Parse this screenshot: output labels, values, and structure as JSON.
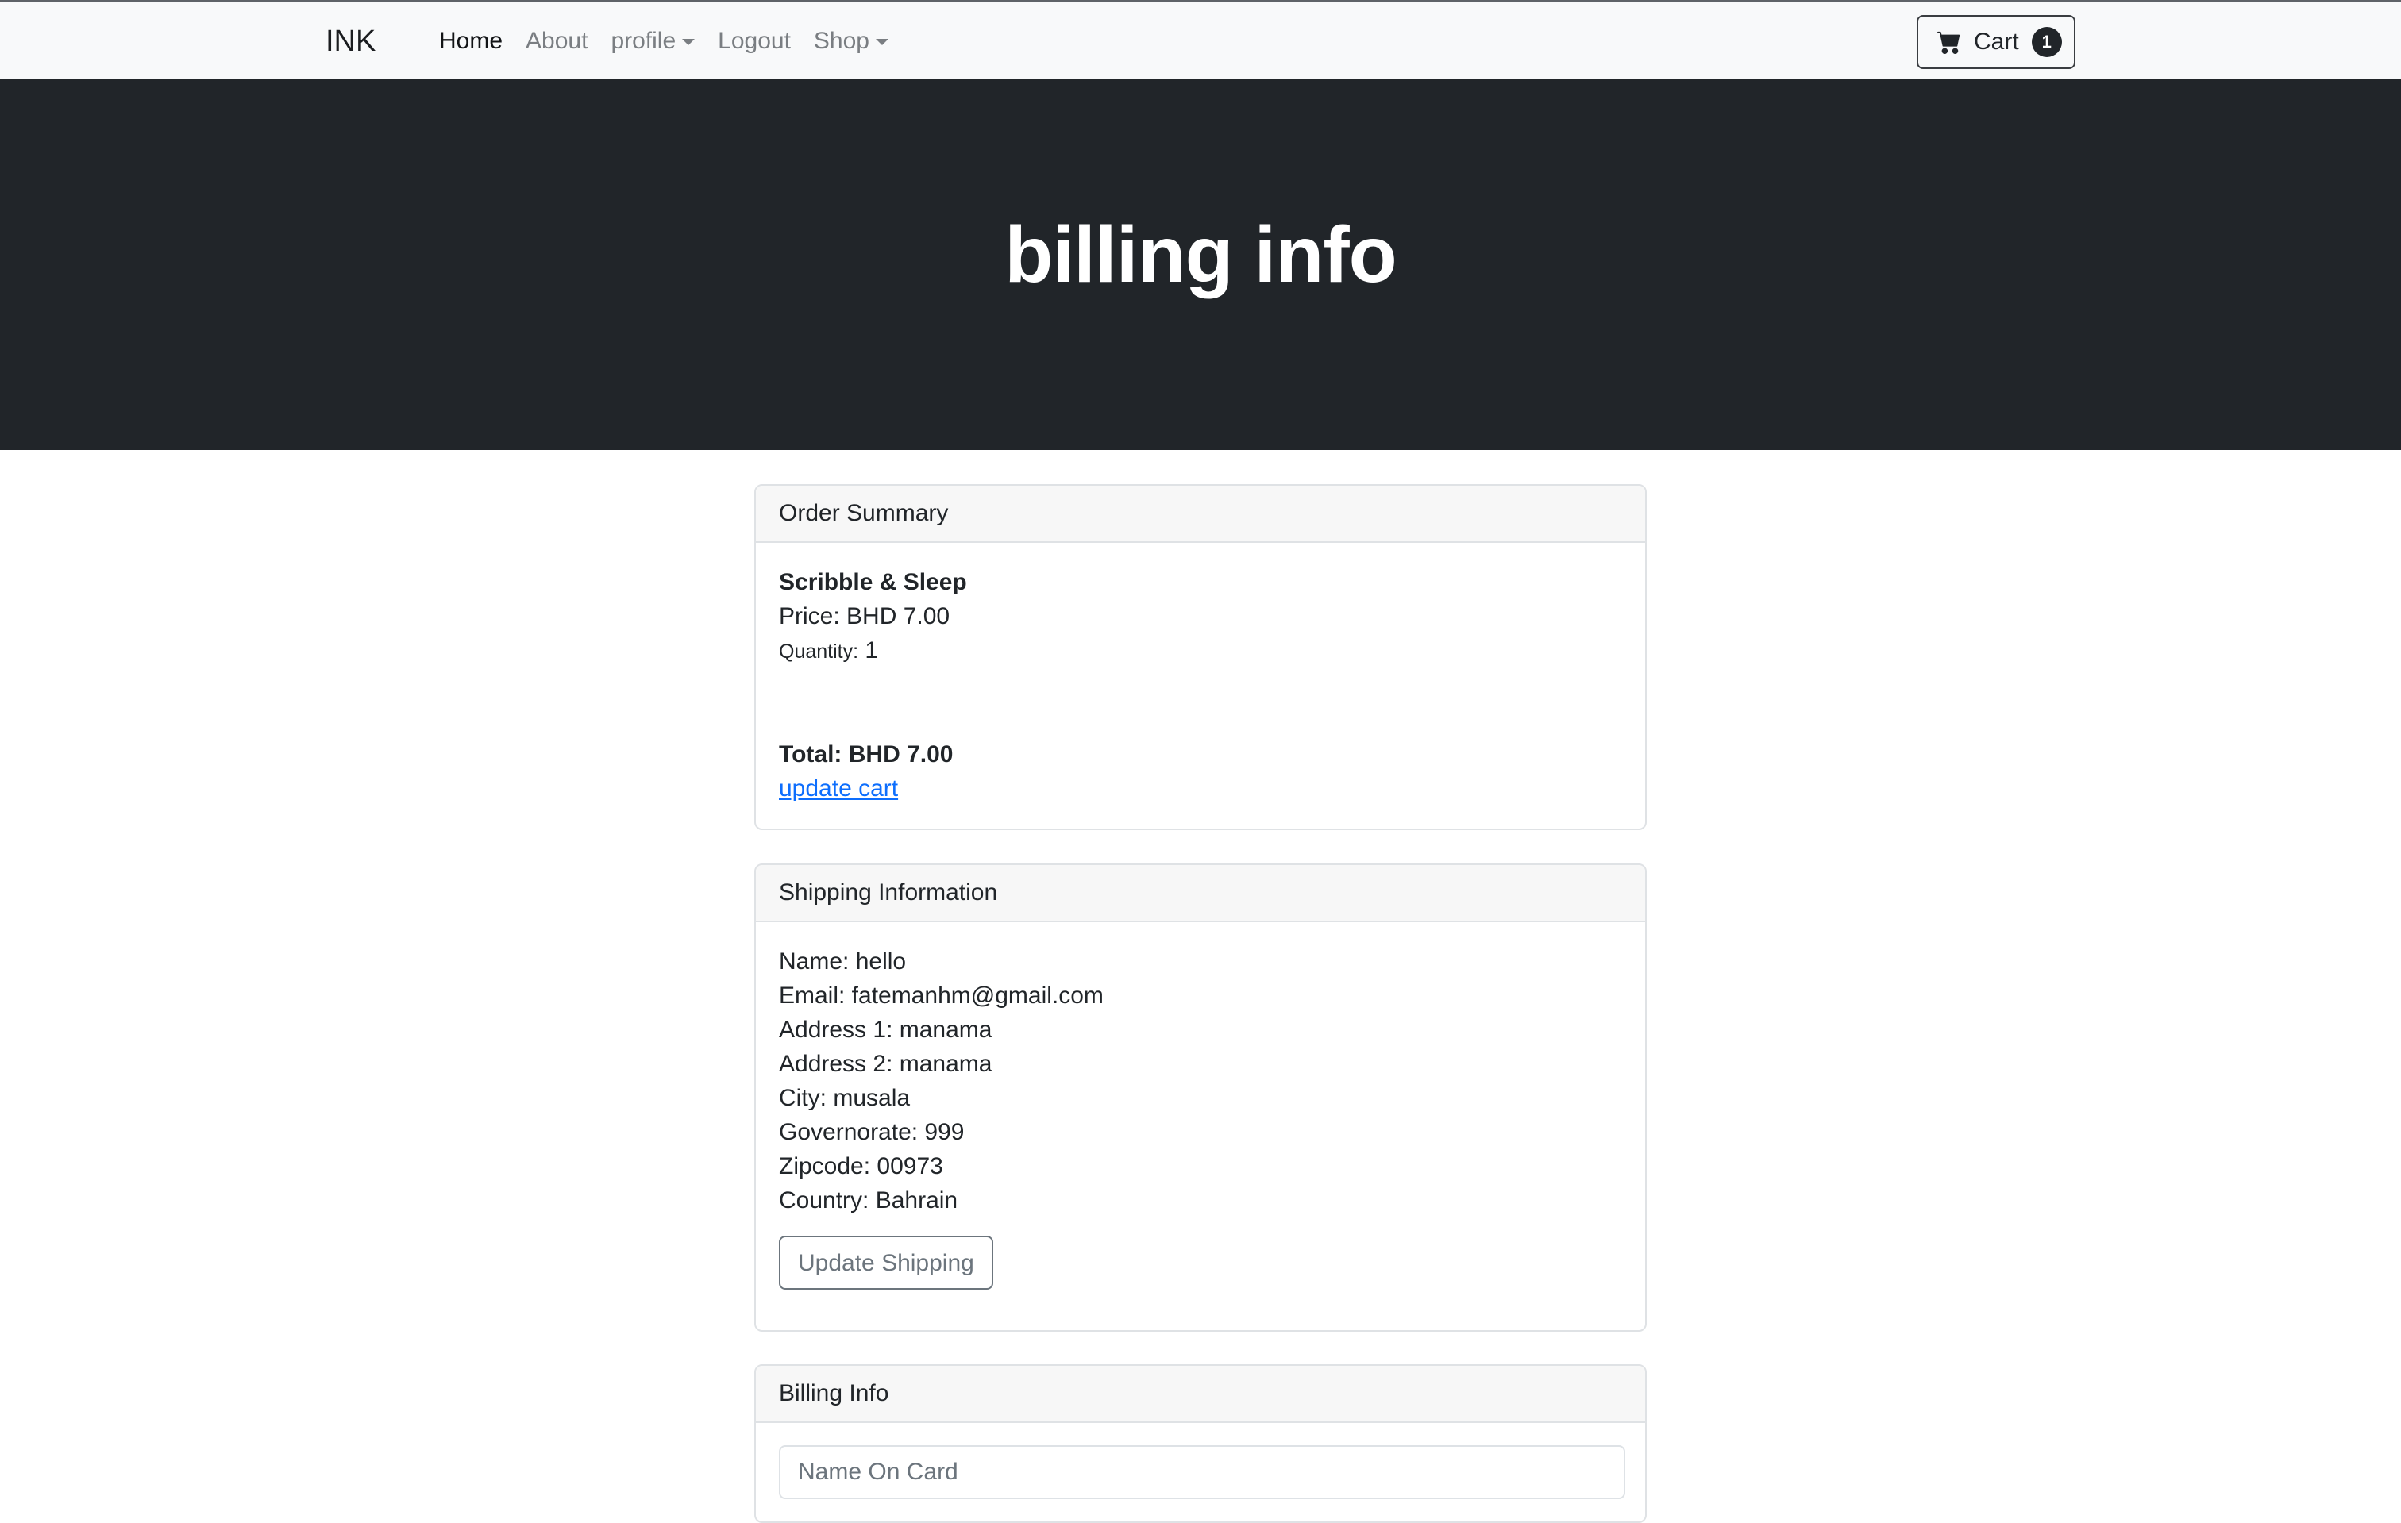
{
  "navbar": {
    "brand": "INK",
    "links": [
      {
        "label": "Home",
        "active": true
      },
      {
        "label": "About"
      },
      {
        "label": "profile",
        "dropdown": true
      },
      {
        "label": "Logout"
      },
      {
        "label": "Shop",
        "dropdown": true
      }
    ],
    "cart": {
      "label": "Cart",
      "count": "1",
      "icon": "cart-icon"
    }
  },
  "hero": {
    "title": "billing info"
  },
  "order_summary": {
    "header": "Order Summary",
    "item_name": "Scribble & Sleep",
    "price": "Price: BHD 7.00",
    "quantity_label": "Quantity:",
    "quantity_value": "1",
    "total": "Total: BHD 7.00",
    "update_link": "update cart"
  },
  "shipping": {
    "header": "Shipping Information",
    "lines": [
      "Name: hello",
      "Email: fatemanhm@gmail.com",
      "Address 1: manama",
      "Address 2: manama",
      "City: musala",
      "Governorate: 999",
      "Zipcode: 00973",
      "Country: Bahrain"
    ],
    "button": "Update Shipping"
  },
  "billing": {
    "header": "Billing Info",
    "name_on_card_placeholder": "Name On Card"
  },
  "colors": {
    "navbar_bg": "#f8f9fa",
    "hero_bg": "#212529",
    "link": "#0d6efd"
  }
}
